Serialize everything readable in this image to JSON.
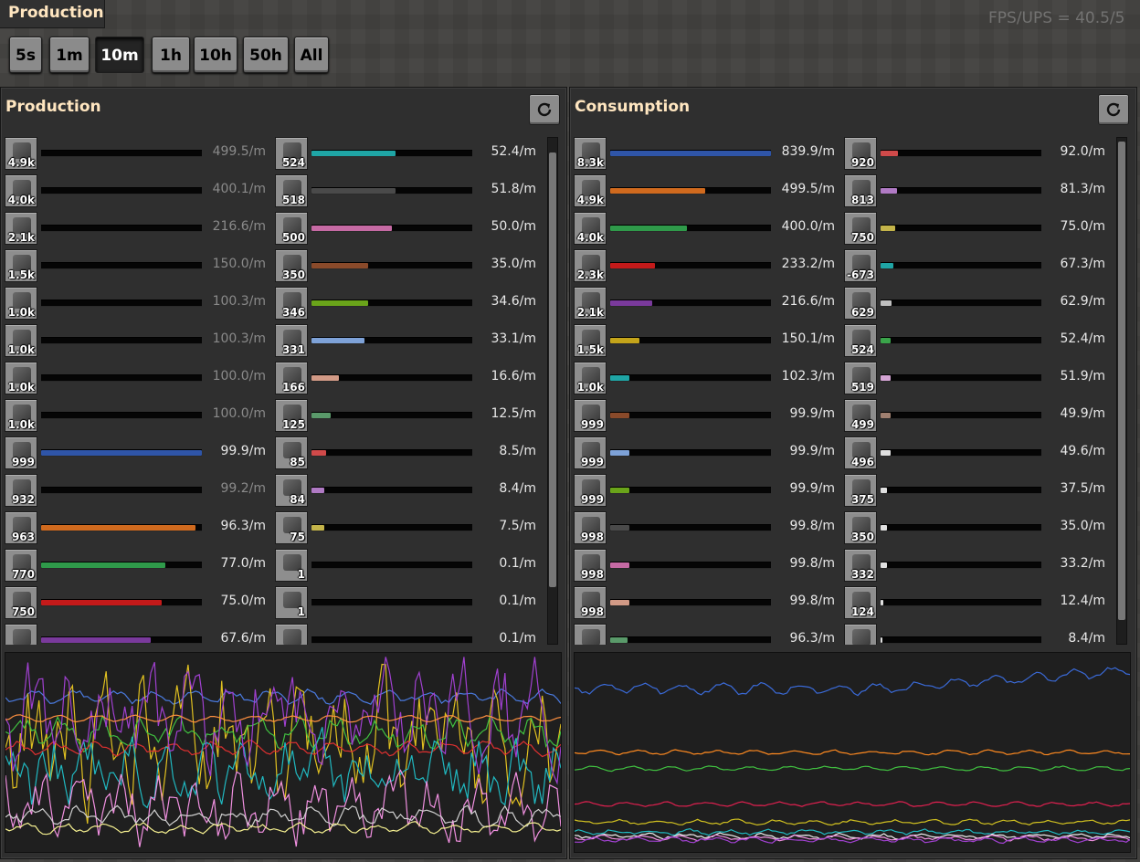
{
  "window": {
    "title": "Production",
    "fps_text": "FPS/UPS = 40.5/5"
  },
  "time_buttons": [
    {
      "label": "5s",
      "active": false
    },
    {
      "label": "1m",
      "active": false
    },
    {
      "label": "10m",
      "active": true
    },
    {
      "label": "1h",
      "active": false
    },
    {
      "label": "10h",
      "active": false
    },
    {
      "label": "50h",
      "active": false
    },
    {
      "label": "All",
      "active": false
    }
  ],
  "production": {
    "title": "Production",
    "reset_icon": "refresh-icon",
    "columns": [
      [
        {
          "count": "4.9k",
          "value": "499.5/m",
          "fill": 0,
          "color": "#c0c0c0",
          "dim": true,
          "icon": "pipe-icon"
        },
        {
          "count": "4.0k",
          "value": "400.1/m",
          "fill": 0,
          "color": "#c0c0c0",
          "dim": true,
          "icon": "copper-cable-icon"
        },
        {
          "count": "2.1k",
          "value": "216.6/m",
          "fill": 0,
          "color": "#c0c0c0",
          "dim": true,
          "icon": "copper-plate-icon"
        },
        {
          "count": "1.5k",
          "value": "150.0/m",
          "fill": 0,
          "color": "#c0c0c0",
          "dim": true,
          "icon": "stone-brick-icon"
        },
        {
          "count": "1.0k",
          "value": "100.3/m",
          "fill": 0,
          "color": "#c0c0c0",
          "dim": true,
          "icon": "steel-plate-icon"
        },
        {
          "count": "1.0k",
          "value": "100.3/m",
          "fill": 0,
          "color": "#c0c0c0",
          "dim": true,
          "icon": "iron-gear-icon"
        },
        {
          "count": "1.0k",
          "value": "100.0/m",
          "fill": 0,
          "color": "#c0c0c0",
          "dim": true,
          "icon": "wood-box-icon"
        },
        {
          "count": "1.0k",
          "value": "100.0/m",
          "fill": 0,
          "color": "#c0c0c0",
          "dim": true,
          "icon": "electronic-circuit-icon"
        },
        {
          "count": "999",
          "value": "99.9/m",
          "fill": 1.0,
          "color": "#2f55a8",
          "dim": false,
          "icon": "circuit-board-icon"
        },
        {
          "count": "932",
          "value": "99.2/m",
          "fill": 0,
          "color": "#c0c0c0",
          "dim": true,
          "icon": "engine-icon"
        },
        {
          "count": "963",
          "value": "96.3/m",
          "fill": 0.96,
          "color": "#d06a1e",
          "dim": false,
          "icon": "plastic-bar-icon"
        },
        {
          "count": "770",
          "value": "77.0/m",
          "fill": 0.77,
          "color": "#2f9a4a",
          "dim": false,
          "icon": "iron-plate-icon"
        },
        {
          "count": "750",
          "value": "75.0/m",
          "fill": 0.75,
          "color": "#c41a1a",
          "dim": false,
          "icon": "stone-icon"
        },
        {
          "count": "",
          "value": "67.6/m",
          "fill": 0.68,
          "color": "#7a3a9c",
          "dim": false,
          "icon": "sapling-icon"
        }
      ],
      [
        {
          "count": "524",
          "value": "52.4/m",
          "fill": 0.52,
          "color": "#1fa5a5",
          "icon": "iron-plate-icon"
        },
        {
          "count": "518",
          "value": "51.8/m",
          "fill": 0.52,
          "color": "#4a4a4a",
          "icon": "battery-icon"
        },
        {
          "count": "500",
          "value": "50.0/m",
          "fill": 0.5,
          "color": "#c66aa4",
          "icon": "wood-plank-icon"
        },
        {
          "count": "350",
          "value": "35.0/m",
          "fill": 0.35,
          "color": "#8a4a2a",
          "icon": "copper-coil-icon"
        },
        {
          "count": "346",
          "value": "34.6/m",
          "fill": 0.35,
          "color": "#6aa41a",
          "icon": "steel-beam-icon"
        },
        {
          "count": "331",
          "value": "33.1/m",
          "fill": 0.33,
          "color": "#7ea2d8",
          "icon": "iron-rod-icon"
        },
        {
          "count": "166",
          "value": "16.6/m",
          "fill": 0.17,
          "color": "#d29a86",
          "icon": "grate-icon"
        },
        {
          "count": "125",
          "value": "12.5/m",
          "fill": 0.12,
          "color": "#5a9a6a",
          "icon": "copper-ore-icon"
        },
        {
          "count": "85",
          "value": "8.5/m",
          "fill": 0.09,
          "color": "#d04a4a",
          "icon": "salt-icon"
        },
        {
          "count": "84",
          "value": "8.4/m",
          "fill": 0.08,
          "color": "#b07ac4",
          "icon": "stone-dust-icon"
        },
        {
          "count": "75",
          "value": "7.5/m",
          "fill": 0.08,
          "color": "#c4b44a",
          "icon": "robot-arm-icon"
        },
        {
          "count": "1",
          "value": "0.1/m",
          "fill": 0,
          "color": "#c0c0c0",
          "icon": "boiler-icon"
        },
        {
          "count": "1",
          "value": "0.1/m",
          "fill": 0,
          "color": "#c0c0c0",
          "icon": "furnace-icon"
        },
        {
          "count": "",
          "value": "0.1/m",
          "fill": 0,
          "color": "#c0c0c0",
          "icon": "gear-icon"
        }
      ]
    ]
  },
  "consumption": {
    "title": "Consumption",
    "reset_icon": "refresh-icon",
    "columns": [
      [
        {
          "count": "8.3k",
          "value": "839.9/m",
          "fill": 1.0,
          "color": "#2f55a8",
          "icon": "coal-icon"
        },
        {
          "count": "4.9k",
          "value": "499.5/m",
          "fill": 0.59,
          "color": "#d06a1e",
          "icon": "pipe-icon"
        },
        {
          "count": "4.0k",
          "value": "400.0/m",
          "fill": 0.48,
          "color": "#2f9a4a",
          "icon": "copper-cable-icon"
        },
        {
          "count": "2.3k",
          "value": "233.2/m",
          "fill": 0.28,
          "color": "#c41a1a",
          "icon": "copper-plate-icon"
        },
        {
          "count": "2.1k",
          "value": "216.6/m",
          "fill": 0.26,
          "color": "#7a3a9c",
          "icon": "copper-ore-icon"
        },
        {
          "count": "1.5k",
          "value": "150.1/m",
          "fill": 0.18,
          "color": "#c4a41a",
          "icon": "stone-icon"
        },
        {
          "count": "1.0k",
          "value": "102.3/m",
          "fill": 0.12,
          "color": "#1fa5a5",
          "icon": "plastic-bar-icon"
        },
        {
          "count": "999",
          "value": "99.9/m",
          "fill": 0.12,
          "color": "#8a4a2a",
          "icon": "engine-icon"
        },
        {
          "count": "999",
          "value": "99.9/m",
          "fill": 0.12,
          "color": "#7ea2d8",
          "icon": "wood-box-icon"
        },
        {
          "count": "999",
          "value": "99.9/m",
          "fill": 0.12,
          "color": "#6aa41a",
          "icon": "electronic-circuit-icon"
        },
        {
          "count": "998",
          "value": "99.8/m",
          "fill": 0.12,
          "color": "#4a4a4a",
          "icon": "steel-plate-icon"
        },
        {
          "count": "998",
          "value": "99.8/m",
          "fill": 0.12,
          "color": "#c66aa4",
          "icon": "iron-gear-icon"
        },
        {
          "count": "998",
          "value": "99.8/m",
          "fill": 0.12,
          "color": "#d29a86",
          "icon": "circuit-board-icon"
        },
        {
          "count": "",
          "value": "96.3/m",
          "fill": 0.11,
          "color": "#5a9a6a",
          "icon": "coal-icon"
        }
      ],
      [
        {
          "count": "920",
          "value": "92.0/m",
          "fill": 0.11,
          "color": "#d04a4a",
          "icon": "iron-ore-icon"
        },
        {
          "count": "813",
          "value": "81.3/m",
          "fill": 0.1,
          "color": "#b07ac4",
          "icon": "iron-plate-icon"
        },
        {
          "count": "750",
          "value": "75.0/m",
          "fill": 0.09,
          "color": "#c4b44a",
          "icon": "stone-brick-icon"
        },
        {
          "count": "-673",
          "value": "67.3/m",
          "fill": 0.08,
          "color": "#1fa5a5",
          "icon": "sapling-icon"
        },
        {
          "count": "629",
          "value": "62.9/m",
          "fill": 0.07,
          "color": "#c0c0c0",
          "icon": "wood-icon"
        },
        {
          "count": "524",
          "value": "52.4/m",
          "fill": 0.06,
          "color": "#3aa44a",
          "icon": "iron-ore-icon"
        },
        {
          "count": "519",
          "value": "51.9/m",
          "fill": 0.06,
          "color": "#d4a4d4",
          "icon": "iron-plate-icon"
        },
        {
          "count": "499",
          "value": "49.9/m",
          "fill": 0.06,
          "color": "#a08070",
          "icon": "wood-plank-icon"
        },
        {
          "count": "496",
          "value": "49.6/m",
          "fill": 0.06,
          "color": "#e0e0e0",
          "icon": "battery-icon"
        },
        {
          "count": "375",
          "value": "37.5/m",
          "fill": 0.04,
          "color": "#e0e0e0",
          "icon": "copper-coil-icon"
        },
        {
          "count": "350",
          "value": "35.0/m",
          "fill": 0.04,
          "color": "#e0e0e0",
          "icon": "steel-beam-icon"
        },
        {
          "count": "332",
          "value": "33.2/m",
          "fill": 0.04,
          "color": "#e0e0e0",
          "icon": "iron-rod-icon"
        },
        {
          "count": "124",
          "value": "12.4/m",
          "fill": 0.015,
          "color": "#e0e0e0",
          "icon": "copper-ore-icon"
        },
        {
          "count": "",
          "value": "8.4/m",
          "fill": 0.01,
          "color": "#e0e0e0",
          "icon": "stone-dust-icon"
        }
      ]
    ]
  },
  "graphs": {
    "production": {
      "series": [
        {
          "color": "#4a7adf",
          "base": 0.22,
          "amp": 0.06,
          "noise": 0.35
        },
        {
          "color": "#e0c020",
          "base": 0.45,
          "amp": 0.35,
          "noise": 0.9
        },
        {
          "color": "#40c040",
          "base": 0.4,
          "amp": 0.12,
          "noise": 0.5
        },
        {
          "color": "#e03030",
          "base": 0.48,
          "amp": 0.06,
          "noise": 0.3
        },
        {
          "color": "#20b8c0",
          "base": 0.6,
          "amp": 0.2,
          "noise": 0.8
        },
        {
          "color": "#f090e0",
          "base": 0.78,
          "amp": 0.18,
          "noise": 0.9
        },
        {
          "color": "#d0d0d0",
          "base": 0.82,
          "amp": 0.06,
          "noise": 0.6
        },
        {
          "color": "#a040d0",
          "base": 0.3,
          "amp": 0.3,
          "noise": 0.9
        },
        {
          "color": "#f5f090",
          "base": 0.88,
          "amp": 0.04,
          "noise": 0.4
        },
        {
          "color": "#ff9040",
          "base": 0.33,
          "amp": 0.03,
          "noise": 0.2
        }
      ]
    },
    "consumption": {
      "series": [
        {
          "color": "#3a6ad8",
          "base": 0.18,
          "amp": 0.05,
          "noise": 0.3,
          "trend": -0.1
        },
        {
          "color": "#ff8a20",
          "base": 0.5,
          "amp": 0.02,
          "noise": 0.3
        },
        {
          "color": "#40c040",
          "base": 0.58,
          "amp": 0.02,
          "noise": 0.3
        },
        {
          "color": "#e02050",
          "base": 0.76,
          "amp": 0.02,
          "noise": 0.3
        },
        {
          "color": "#d0c020",
          "base": 0.85,
          "amp": 0.02,
          "noise": 0.4
        },
        {
          "color": "#20b8c0",
          "base": 0.9,
          "amp": 0.02,
          "noise": 0.5
        },
        {
          "color": "#f0f0f0",
          "base": 0.92,
          "amp": 0.02,
          "noise": 0.5
        },
        {
          "color": "#f090e0",
          "base": 0.93,
          "amp": 0.02,
          "noise": 0.5
        },
        {
          "color": "#a040d0",
          "base": 0.94,
          "amp": 0.02,
          "noise": 0.5
        }
      ]
    }
  }
}
